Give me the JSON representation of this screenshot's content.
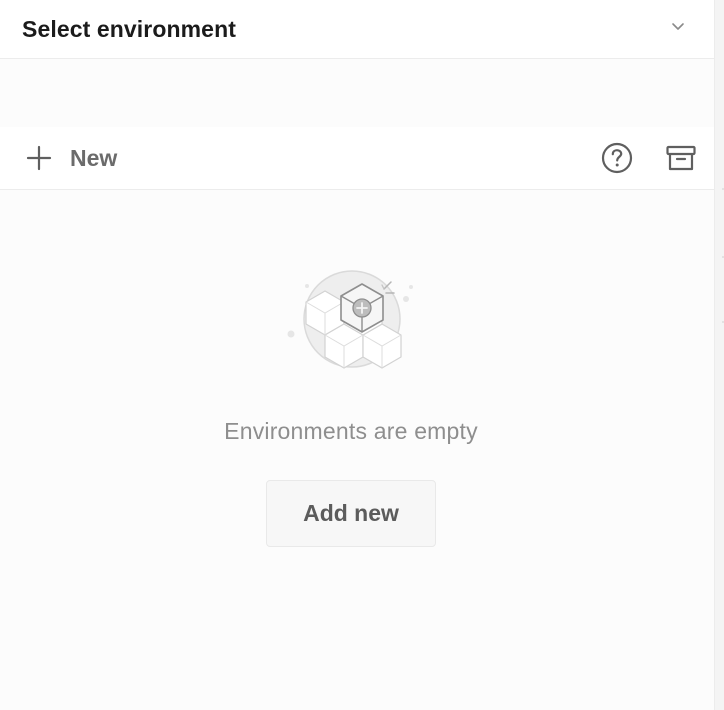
{
  "environment_selector": {
    "title": "Select environment"
  },
  "toolbar": {
    "new_label": "New"
  },
  "empty_state": {
    "message": "Environments are empty",
    "add_button_label": "Add new"
  },
  "icons": {
    "chevron": "chevron-down-icon",
    "plus": "plus-icon",
    "help": "help-circle-icon",
    "archive": "archive-icon",
    "empty": "empty-cubes-illustration"
  },
  "colors": {
    "header_text": "#1b1b1b",
    "muted_text": "#8e8e8e",
    "icon_gray": "#5f5f5f",
    "border": "#ececec"
  }
}
